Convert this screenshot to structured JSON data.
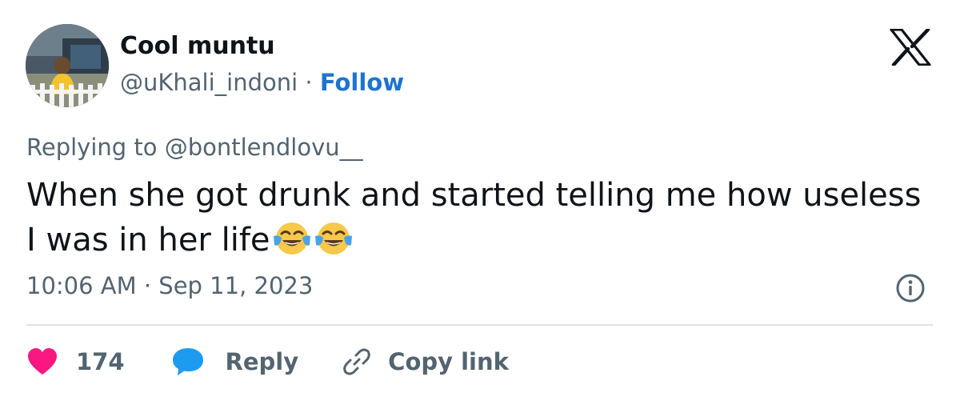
{
  "author": {
    "display_name": "Cool muntu",
    "handle": "@uKhali_indoni",
    "separator": "·",
    "follow_label": "Follow"
  },
  "reply_context": "Replying to @bontlendlovu__",
  "tweet": {
    "text": "When she got drunk and started telling me how useless I was in her life",
    "emojis": [
      "face-with-tears-of-joy",
      "face-with-tears-of-joy"
    ]
  },
  "timestamp": "10:06 AM · Sep 11, 2023",
  "actions": {
    "like_count": "174",
    "reply_label": "Reply",
    "copy_link_label": "Copy link"
  },
  "icons": [
    "x-logo",
    "info-icon",
    "heart-icon",
    "speech-bubble-icon",
    "link-icon"
  ],
  "colors": {
    "follow": "#1d74cf",
    "heart": "#f91880",
    "reply_bubble": "#1d9bf0",
    "secondary_text": "#536471",
    "divider": "#dde2e6"
  }
}
